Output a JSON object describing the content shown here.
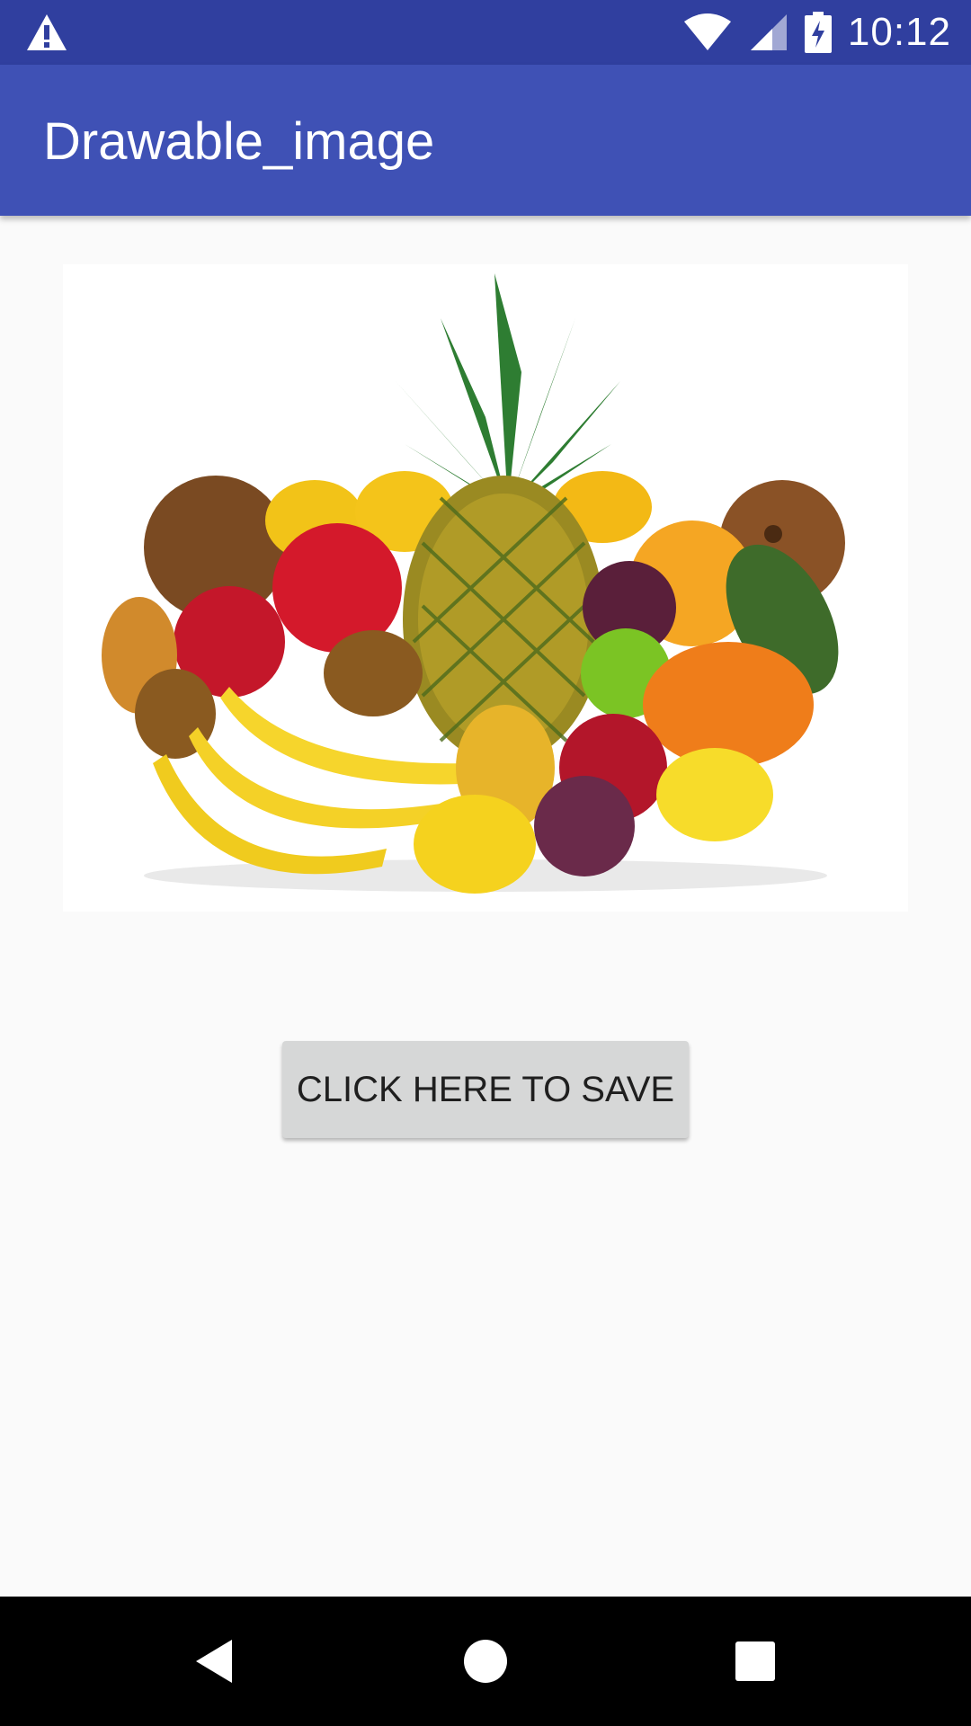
{
  "status_bar": {
    "time": "10:12",
    "icons": [
      "alert-icon",
      "wifi-icon",
      "signal-icon",
      "battery-charging-icon"
    ]
  },
  "app_bar": {
    "title": "Drawable_image",
    "color": "#3f51b5",
    "status_color": "#303f9f"
  },
  "image": {
    "subject": "fruit-assortment-image"
  },
  "button": {
    "label": "CLICK HERE TO SAVE"
  },
  "nav_bar": {
    "icons": [
      "back-icon",
      "home-icon",
      "recents-icon"
    ]
  }
}
